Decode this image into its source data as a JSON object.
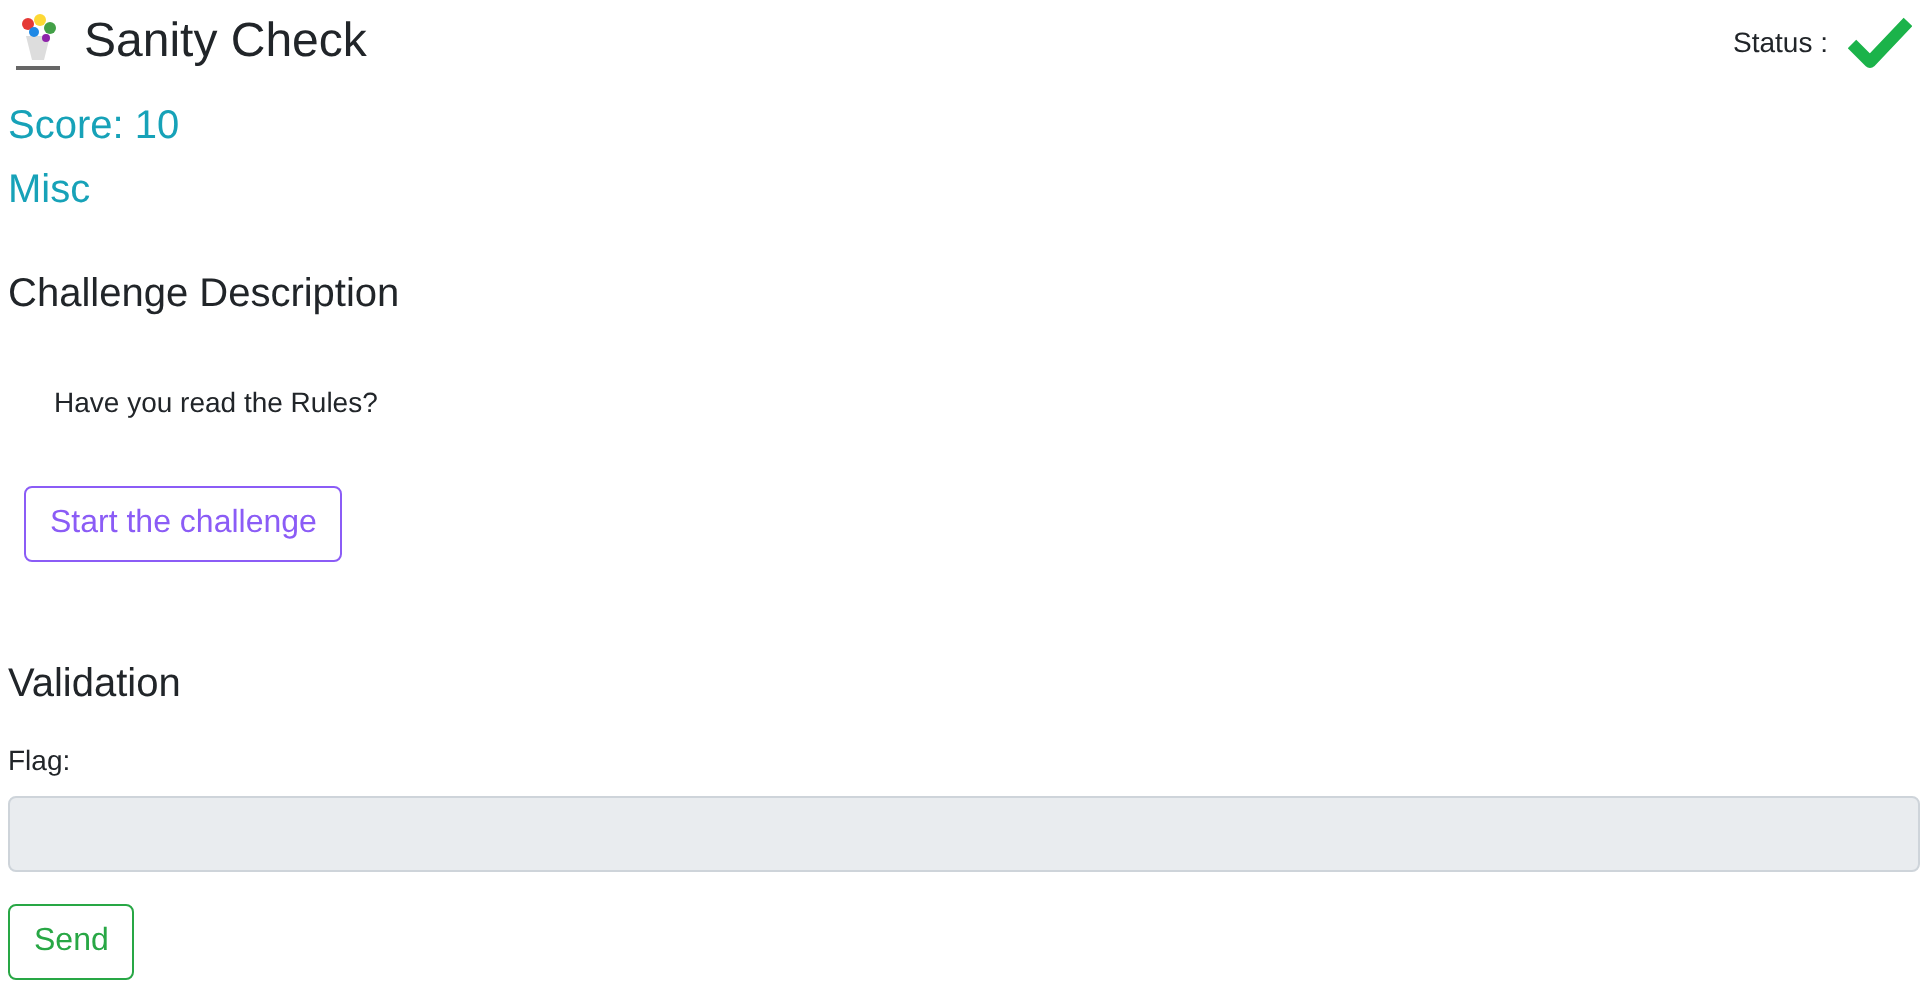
{
  "header": {
    "title": "Sanity Check",
    "status_label": "Status :",
    "solved": true
  },
  "score": "Score: 10",
  "category": "Misc",
  "description": {
    "heading": "Challenge Description",
    "text": "Have you read the Rules?",
    "start_button": "Start the challenge"
  },
  "validation": {
    "heading": "Validation",
    "flag_label": "Flag:",
    "flag_disabled": true,
    "send_button": "Send"
  }
}
